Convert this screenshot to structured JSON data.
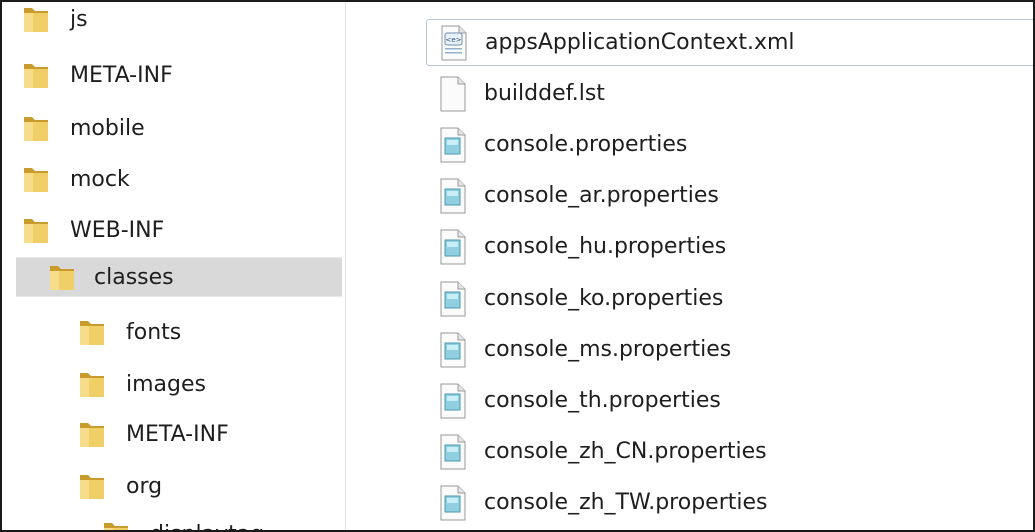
{
  "tree": {
    "items": [
      {
        "label": "js"
      },
      {
        "label": "META-INF"
      },
      {
        "label": "mobile"
      },
      {
        "label": "mock"
      },
      {
        "label": "WEB-INF"
      },
      {
        "label": "classes"
      },
      {
        "label": "fonts"
      },
      {
        "label": "images"
      },
      {
        "label": "META-INF"
      },
      {
        "label": "org"
      },
      {
        "label": "displaytag"
      }
    ],
    "selected": "classes"
  },
  "files": {
    "items": [
      {
        "name": "appsApplicationContext.xml",
        "icon": "xml-file-icon"
      },
      {
        "name": "builddef.lst",
        "icon": "blank-file-icon"
      },
      {
        "name": "console.properties",
        "icon": "properties-file-icon"
      },
      {
        "name": "console_ar.properties",
        "icon": "properties-file-icon"
      },
      {
        "name": "console_hu.properties",
        "icon": "properties-file-icon"
      },
      {
        "name": "console_ko.properties",
        "icon": "properties-file-icon"
      },
      {
        "name": "console_ms.properties",
        "icon": "properties-file-icon"
      },
      {
        "name": "console_th.properties",
        "icon": "properties-file-icon"
      },
      {
        "name": "console_zh_CN.properties",
        "icon": "properties-file-icon"
      },
      {
        "name": "console_zh_TW.properties",
        "icon": "properties-file-icon"
      }
    ],
    "focused": "appsApplicationContext.xml"
  },
  "colors": {
    "selection": "#d9d9d9",
    "folder": "#e8c45a",
    "focus_border": "#b9c6d6"
  }
}
